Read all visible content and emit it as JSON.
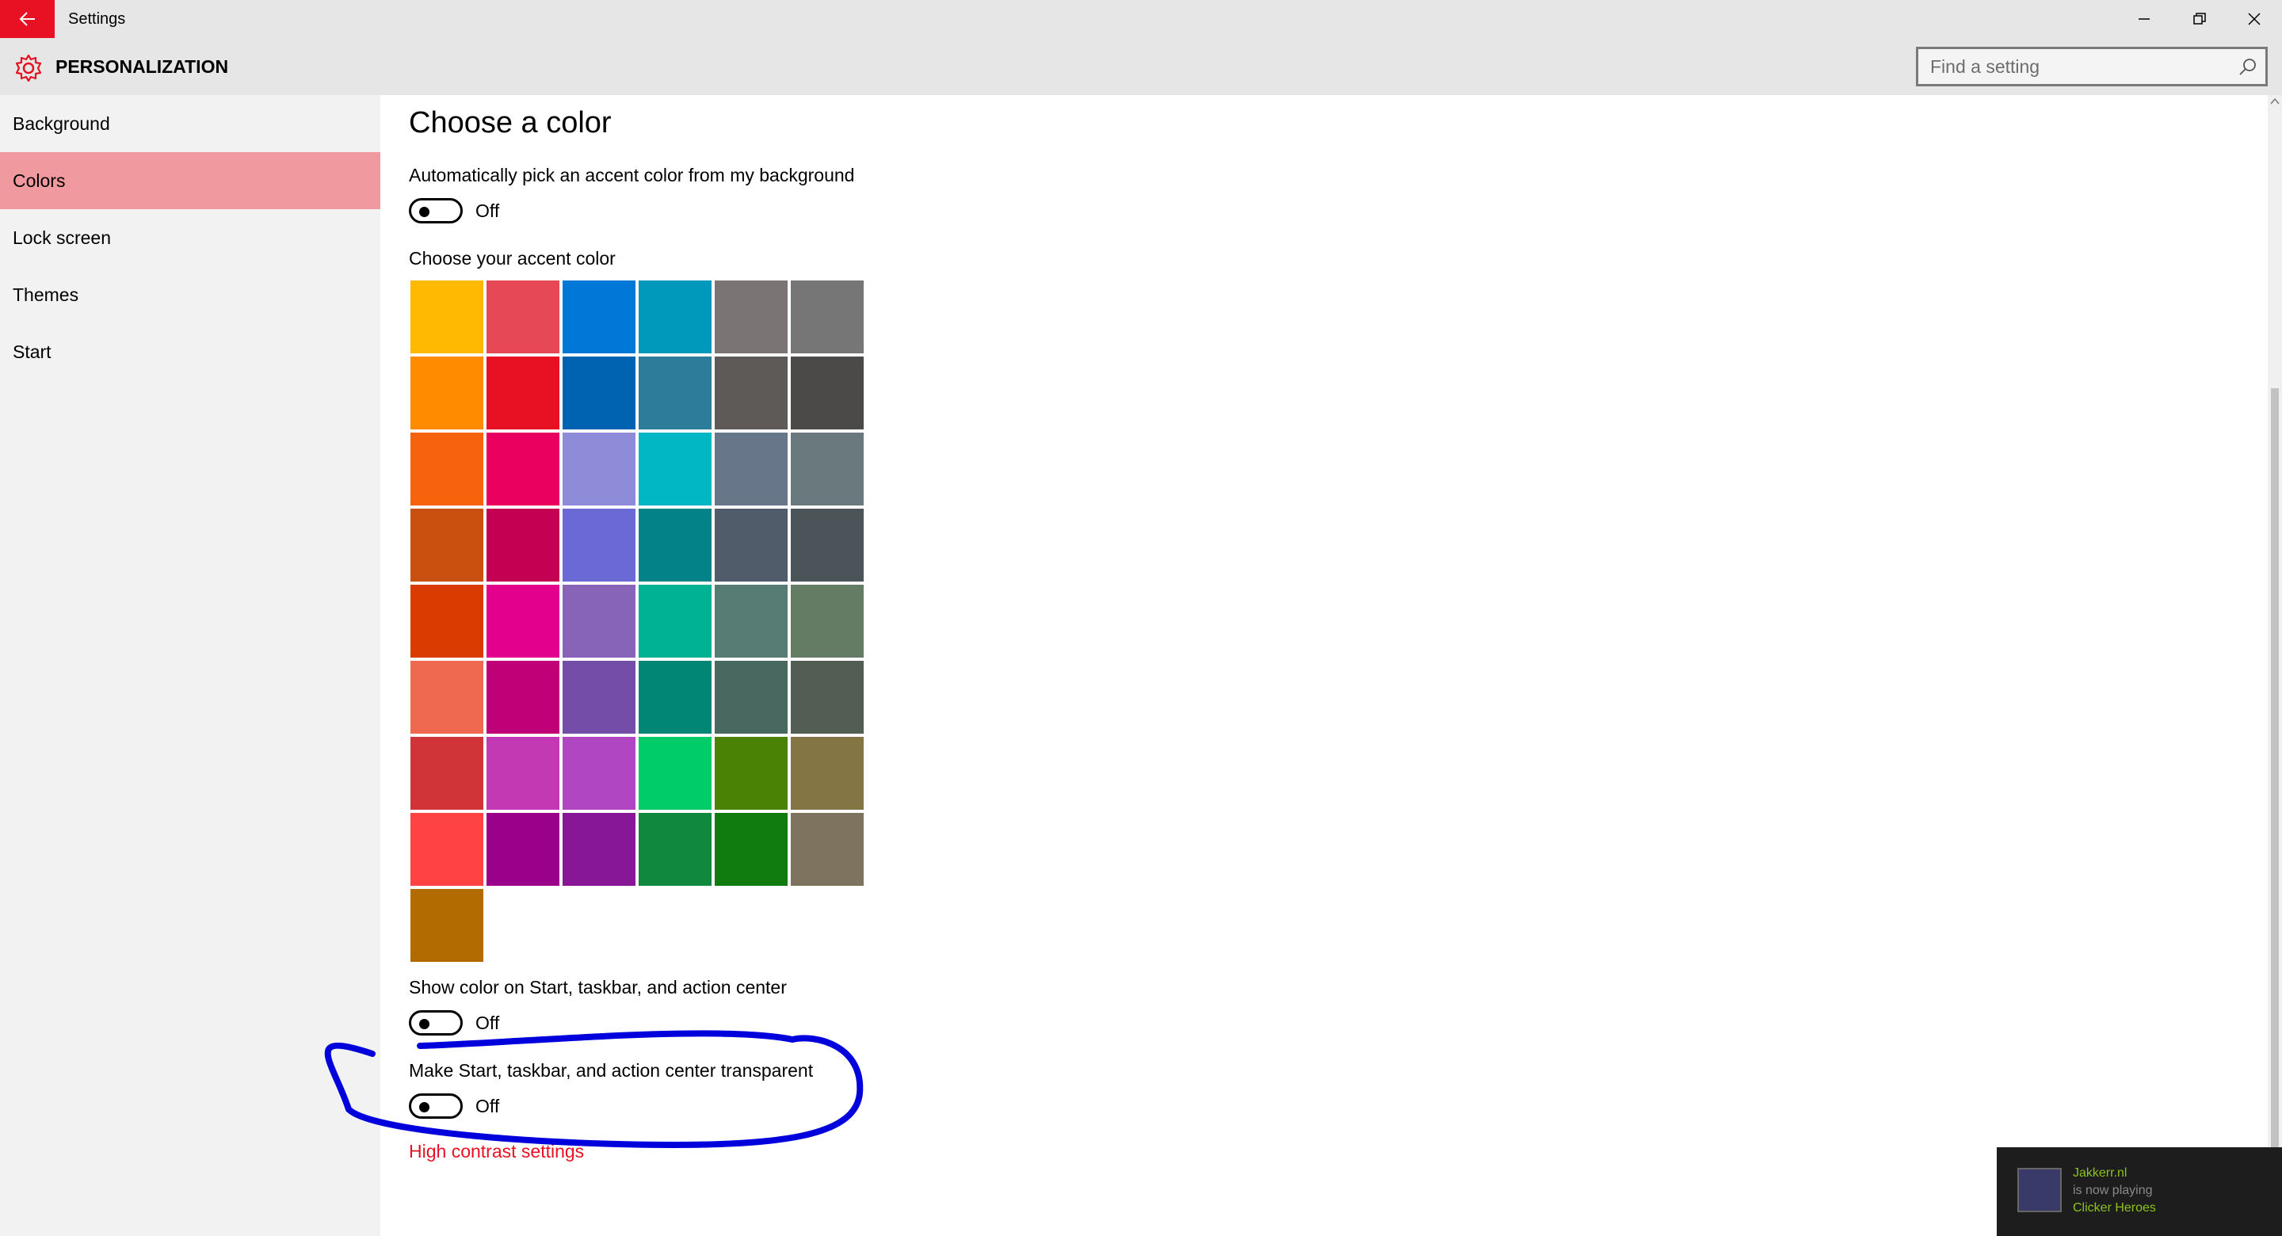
{
  "titlebar": {
    "title": "Settings",
    "back_icon": "back-arrow-icon",
    "minimize_icon": "minimize-icon",
    "restore_icon": "restore-icon",
    "close_icon": "close-icon"
  },
  "header": {
    "icon": "gear-icon",
    "title": "PERSONALIZATION",
    "search_placeholder": "Find a setting",
    "search_icon": "search-icon"
  },
  "sidebar": {
    "items": [
      {
        "label": "Background",
        "active": false
      },
      {
        "label": "Colors",
        "active": true
      },
      {
        "label": "Lock screen",
        "active": false
      },
      {
        "label": "Themes",
        "active": false
      },
      {
        "label": "Start",
        "active": false
      }
    ]
  },
  "main": {
    "heading": "Choose a color",
    "auto_pick": {
      "label": "Automatically pick an accent color from my background",
      "state": "Off"
    },
    "accent_label": "Choose your accent color",
    "accent_colors": [
      "#ffb900",
      "#e74856",
      "#0078d7",
      "#0099bc",
      "#7a7574",
      "#767676",
      "#ff8c00",
      "#e81123",
      "#0063b1",
      "#2d7d9a",
      "#5d5a58",
      "#4c4a48",
      "#f7630c",
      "#ea005e",
      "#8e8cd8",
      "#00b7c3",
      "#68768a",
      "#69797e",
      "#ca5010",
      "#c30052",
      "#6b69d6",
      "#038387",
      "#515c6b",
      "#4a5459",
      "#da3b01",
      "#e3008c",
      "#8764b8",
      "#00b294",
      "#567c73",
      "#647c64",
      "#ef6950",
      "#bf0077",
      "#744da9",
      "#018574",
      "#486860",
      "#525e54",
      "#d13438",
      "#c239b3",
      "#b146c2",
      "#00cc6a",
      "#498205",
      "#847545",
      "#ff4343",
      "#9a0089",
      "#881798",
      "#10893e",
      "#107c10",
      "#7e735f",
      "#b26b00"
    ],
    "show_color": {
      "label": "Show color on Start, taskbar, and action center",
      "state": "Off"
    },
    "transparent": {
      "label": "Make Start, taskbar, and action center transparent",
      "state": "Off"
    },
    "link": "High contrast settings"
  },
  "toast": {
    "line1": "Jakkerr.nl",
    "line2": "is now playing",
    "line3": "Clicker Heroes",
    "accent": "#8dc21f"
  },
  "colors": {
    "titlebar_bg": "#e6e6e6",
    "back_button": "#e81123",
    "sidebar_bg": "#f2f2f2",
    "sidebar_active": "#f0999f",
    "annotation": "#0000dd",
    "link": "#e81123"
  }
}
